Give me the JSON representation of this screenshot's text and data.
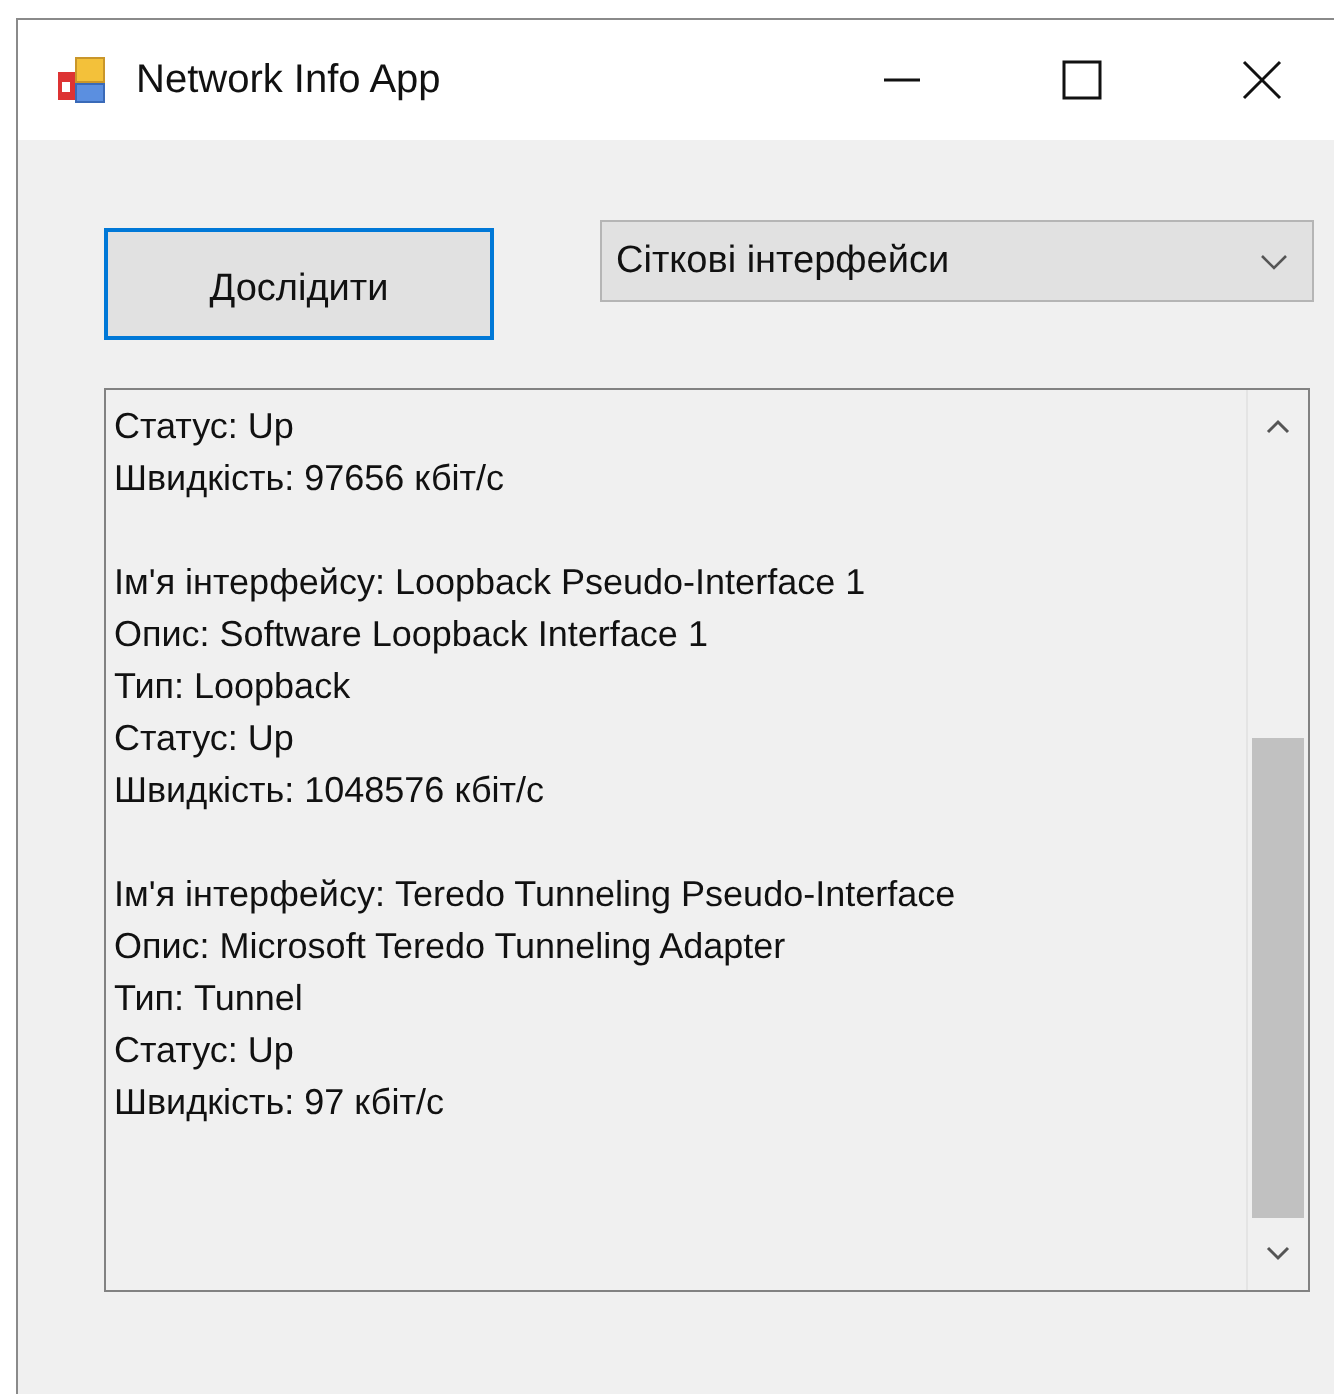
{
  "window": {
    "title": "Network Info App"
  },
  "explore_button": {
    "label": "Дослідити",
    "focused": true
  },
  "dropdown": {
    "value": "Сіткові інтерфейси"
  },
  "output": {
    "paragraphs": [
      [
        "Статус: Up",
        "Швидкість: 97656 кбіт/с"
      ],
      [
        "Ім'я інтерфейсу: Loopback Pseudo-Interface 1",
        "Опис: Software Loopback Interface 1",
        "Тип: Loopback",
        "Статус: Up",
        "Швидкість: 1048576 кбіт/с"
      ],
      [
        "Ім'я інтерфейсу: Teredo Tunneling Pseudo-Interface",
        "Опис: Microsoft Teredo Tunneling Adapter",
        "Тип: Tunnel",
        "Статус: Up",
        "Швидкість: 97 кбіт/с"
      ]
    ]
  }
}
